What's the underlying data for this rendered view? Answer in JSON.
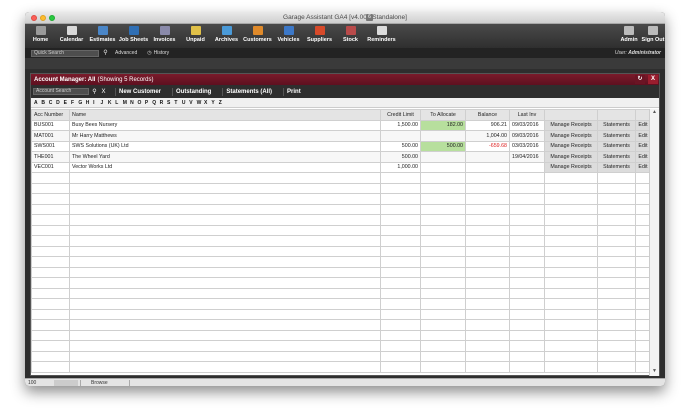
{
  "window": {
    "title": "Garage Assistant GA4 [v4.003 Standalone]"
  },
  "toolbar": {
    "items": [
      {
        "label": "Home",
        "icon": "home-icon",
        "color": "#9a9a9a"
      },
      {
        "label": "Calendar",
        "icon": "calendar-icon",
        "color": "#d9d9d9"
      },
      {
        "label": "Estimates",
        "icon": "estimates-icon",
        "color": "#4a86c8"
      },
      {
        "label": "Job Sheets",
        "icon": "job-sheets-icon",
        "color": "#2f6fb5"
      },
      {
        "label": "Invoices",
        "icon": "invoices-icon",
        "color": "#8a8aaa"
      },
      {
        "label": "Unpaid",
        "icon": "unpaid-icon",
        "color": "#e0c048"
      },
      {
        "label": "Archives",
        "icon": "archives-icon",
        "color": "#4a9ad8"
      },
      {
        "label": "Customers",
        "icon": "customers-icon",
        "color": "#e08a2a"
      },
      {
        "label": "Vehicles",
        "icon": "vehicles-icon",
        "color": "#3c78c8"
      },
      {
        "label": "Suppliers",
        "icon": "suppliers-icon",
        "color": "#d84a2a"
      },
      {
        "label": "Stock",
        "icon": "stock-icon",
        "color": "#b84a4a"
      },
      {
        "label": "Reminders",
        "icon": "reminders-icon",
        "color": "#dcdcdc"
      }
    ],
    "stock_badge": "6",
    "right_items": [
      {
        "label": "Admin",
        "icon": "admin-icon",
        "color": "#bbbbbb"
      },
      {
        "label": "Sign Out",
        "icon": "sign-out-icon",
        "color": "#bbbbbb"
      }
    ]
  },
  "subbar": {
    "quick_search_placeholder": "Quick Search",
    "advanced_label": "Advanced",
    "history_label": "History",
    "user_prefix": "User:",
    "user_name": "Administrator"
  },
  "panel": {
    "title": "Account Manager: All",
    "subtitle": "(Showing 5 Records)",
    "search_placeholder": "Account Search",
    "clear_symbol": "X",
    "actions": [
      "New Customer",
      "Outstanding",
      "Statements (All)",
      "Print"
    ],
    "alphabet": [
      "A",
      "B",
      "C",
      "D",
      "E",
      "F",
      "G",
      "H",
      "I",
      "J",
      "K",
      "L",
      "M",
      "N",
      "O",
      "P",
      "Q",
      "R",
      "S",
      "T",
      "U",
      "V",
      "W",
      "X",
      "Y",
      "Z"
    ],
    "columns": [
      "Acc Number",
      "Name",
      "Credit Limit",
      "To Allocate",
      "Balance",
      "Last Inv",
      "",
      "",
      ""
    ],
    "rows": [
      {
        "acc": "BUS001",
        "name": "Busy Bees Nursery",
        "credit": "1,500.00",
        "allocate": "182.00",
        "balance": "906.21",
        "last_inv": "09/03/2016",
        "receipts": "Manage Receipts",
        "statements": "Statements",
        "edit": "Edit"
      },
      {
        "acc": "MAT001",
        "name": "Mr Harry Matthews",
        "credit": "",
        "allocate": "",
        "balance": "1,004.00",
        "last_inv": "09/03/2016",
        "receipts": "Manage Receipts",
        "statements": "Statements",
        "edit": "Edit"
      },
      {
        "acc": "SWS001",
        "name": "SWS Solutions (UK) Ltd",
        "credit": "500.00",
        "allocate": "500.00",
        "balance": "-659.68",
        "last_inv": "03/03/2016",
        "receipts": "Manage Receipts",
        "statements": "Statements",
        "edit": "Edit"
      },
      {
        "acc": "THE001",
        "name": "The Wheel Yard",
        "credit": "500.00",
        "allocate": "",
        "balance": "",
        "last_inv": "19/04/2016",
        "receipts": "Manage Receipts",
        "statements": "Statements",
        "edit": "Edit"
      },
      {
        "acc": "VEC001",
        "name": "Vector Works Ltd",
        "credit": "1,000.00",
        "allocate": "",
        "balance": "",
        "last_inv": "",
        "receipts": "Manage Receipts",
        "statements": "Statements",
        "edit": "Edit"
      }
    ]
  },
  "status": {
    "zoom": "100",
    "mode": "Browse"
  }
}
